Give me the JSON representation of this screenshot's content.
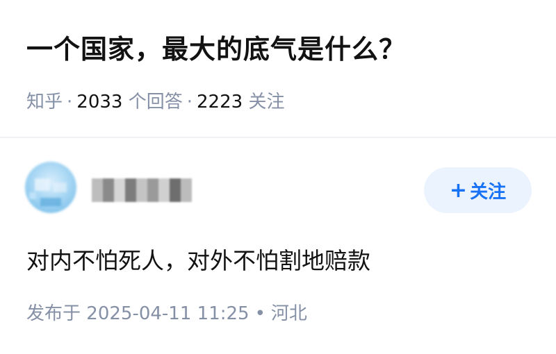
{
  "question": {
    "title": "一个国家，最大的底气是什么？",
    "source": "知乎",
    "answer_count": "2033",
    "answer_label": "个回答",
    "follower_count": "2223",
    "follower_label": "关注",
    "separator": "·"
  },
  "answer": {
    "author_avatar_icon": "avatar-blurred",
    "author_name_icon": "username-blurred",
    "follow_button_plus": "+",
    "follow_button_label": "关注",
    "content": "对内不怕死人，对外不怕割地赔款",
    "published_prefix": "发布于",
    "published_time": "2025-04-11 11:25",
    "dot": "•",
    "location": "河北"
  },
  "colors": {
    "accent": "#1772f6",
    "accent_bg": "#ebf3ff",
    "meta_gray": "#8590a6",
    "text": "#121212"
  }
}
